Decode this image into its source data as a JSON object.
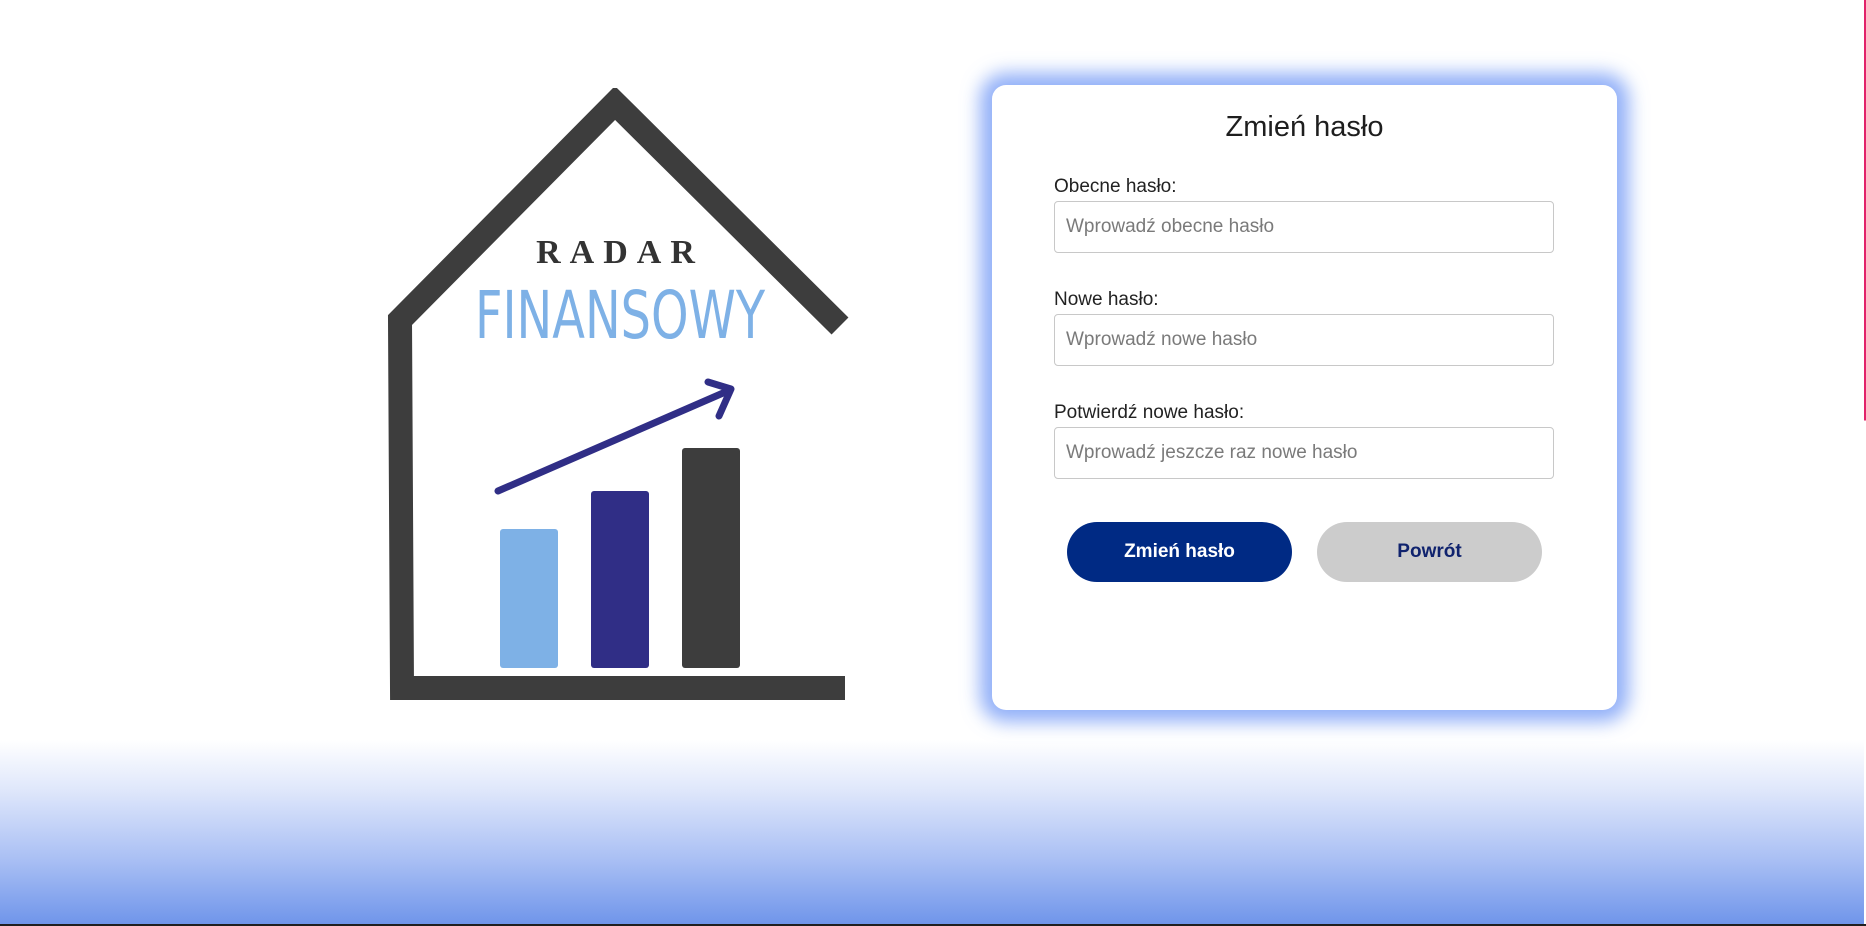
{
  "logo": {
    "line1": "RADAR",
    "line2": "FINANSOWY",
    "colors": {
      "house": "#3d3d3d",
      "bar_light": "#7eb1e6",
      "bar_mid": "#302e86",
      "bar_dark": "#3d3d3d",
      "arrow": "#302e86",
      "finansowy_text": "#7eb1e6"
    }
  },
  "form": {
    "title": "Zmień hasło",
    "fields": [
      {
        "label": "Obecne hasło:",
        "placeholder": "Wprowadź obecne hasło",
        "value": ""
      },
      {
        "label": "Nowe hasło:",
        "placeholder": "Wprowadź nowe hasło",
        "value": ""
      },
      {
        "label": "Potwierdź nowe hasło:",
        "placeholder": "Wprowadź jeszcze raz nowe hasło",
        "value": ""
      }
    ],
    "submit_label": "Zmień hasło",
    "back_label": "Powrót"
  },
  "colors": {
    "primary_button": "#002a84",
    "secondary_button": "#cccccc",
    "card_glow": "#6e96f5",
    "bottom_gradient": "#6e94ea"
  }
}
